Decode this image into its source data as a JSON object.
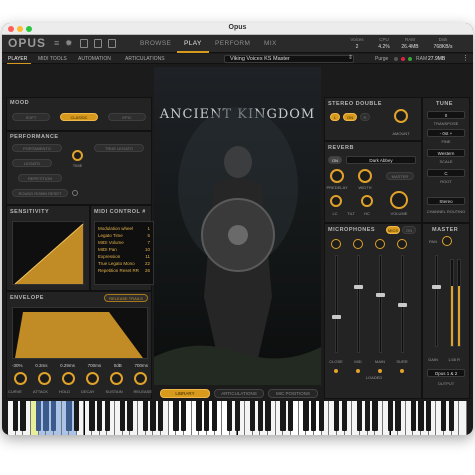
{
  "window_title": "Opus",
  "logo": "OPUS",
  "nav": {
    "items": [
      "BROWSE",
      "PLAY",
      "PERFORM",
      "MIX"
    ],
    "active": "PLAY"
  },
  "stats": [
    {
      "label": "Voices",
      "value": "2"
    },
    {
      "label": "CPU",
      "value": "4.2%"
    },
    {
      "label": "RAM",
      "value": "26.4MB"
    },
    {
      "label": "Disk",
      "value": "768KB/s"
    }
  ],
  "subtabs": {
    "items": [
      "PLAYER",
      "MIDI TOOLS",
      "AUTOMATION",
      "ARTICULATIONS"
    ],
    "active": "PLAYER"
  },
  "preset": "Viking Voices KS Master",
  "purge_label": "Purge",
  "ram_label": "RAM",
  "ram_value": "27.9MB",
  "mood": {
    "title": "MOOD",
    "options": [
      "SOFT",
      "CLASSIC",
      "EPIC"
    ],
    "selected": "CLASSIC"
  },
  "performance": {
    "title": "PERFORMANCE",
    "buttons": [
      "PORTAMENTO",
      "TRUE LEGATO",
      "LEGATO",
      "REPETITION",
      "ROUND ROBIN RESET"
    ],
    "time_label": "TIME"
  },
  "sensitivity": {
    "title": "SENSITIVITY"
  },
  "midi_control": {
    "title": "MIDI CONTROL #",
    "rows": [
      {
        "name": "Modulation wheel",
        "cc": "1"
      },
      {
        "name": "Legato Time",
        "cc": "5"
      },
      {
        "name": "MIDI Volume",
        "cc": "7"
      },
      {
        "name": "MIDI Pan",
        "cc": "10"
      },
      {
        "name": "Expression",
        "cc": "11"
      },
      {
        "name": "True Legato Mono",
        "cc": "22"
      },
      {
        "name": "Repetition Reset RR",
        "cc": "26"
      }
    ]
  },
  "envelope": {
    "title": "ENVELOPE",
    "release_trails": "RELEASE TRAILS",
    "values": [
      "-30%",
      "0.3ms",
      "0.29ms",
      "700ms",
      "0dB",
      "700ms"
    ],
    "knobs": [
      "CURVE",
      "ATTACK",
      "HOLD",
      "DECAY",
      "SUSTAIN",
      "RELEASE"
    ]
  },
  "artwork": {
    "title": "ANCIENT KINGDOM"
  },
  "stereo_double": {
    "title": "STEREO DOUBLE",
    "l": "L",
    "on": "ON",
    "r": "R",
    "amount": "AMOUNT"
  },
  "tune": {
    "title": "TUNE",
    "value": "0",
    "transpose_label": "TRANSPOSE",
    "transpose": "- 0st +",
    "fine_label": "FINE",
    "scale": "Western",
    "scale_label": "SCALE",
    "root": "C",
    "root_label": "ROOT",
    "output": "Stereo",
    "routing_label": "CHANNEL ROUTING"
  },
  "reverb": {
    "title": "REVERB",
    "on": "ON",
    "preset": "Dark Abbey",
    "master": "MASTER",
    "knobs": [
      "PREDELAY",
      "WIDTH",
      "LC",
      "HC",
      "VOLUME"
    ],
    "tilt": "TILT"
  },
  "microphones": {
    "title": "MICROPHONES",
    "mics": "MICS",
    "on": "ON",
    "channels": [
      "CLOSE",
      "MID",
      "MAIN",
      "SURR"
    ],
    "loaded": "LOADED",
    "pan": "PAN"
  },
  "master": {
    "title": "MASTER",
    "gain": "GAIN",
    "gain_value": "1.58 R",
    "output": "Opus 1 & 2",
    "output_label": "OUTPUT"
  },
  "bottom_tabs": [
    "LIBRARY",
    "ARTICULATIONS",
    "MIC POSITIONS"
  ],
  "keyboard": {
    "labels": [
      "C1",
      "C4"
    ]
  }
}
